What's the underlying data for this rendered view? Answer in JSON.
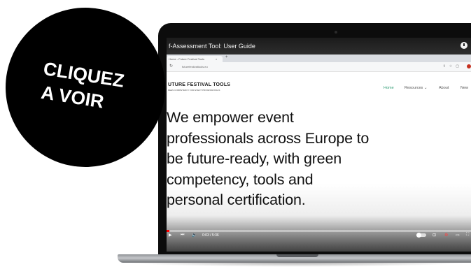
{
  "video": {
    "title": "f-Assessment Tool: User Guide",
    "time": "0:03 / 5:36",
    "progress_fraction": 0.01
  },
  "browser": {
    "tab_title": "Home - Future Festival Tools",
    "tab_close": "×",
    "new_tab": "+",
    "url": "futurefestivaltools.eu"
  },
  "site": {
    "logo_text": "UTURE FESTIVAL TOOLS",
    "logo_subtitle": "REEN COMPETENCY FOR EVENT PROFESSIONALS",
    "nav": {
      "home": "Home",
      "resources": "Resources ⌄",
      "about": "About",
      "news": "New"
    },
    "hero_text": "We empower event\nprofessionals across Europe to\nbe future-ready, with green\ncompetency, tools and\npersonal certification."
  },
  "badge": {
    "line1": "CLIQUEZ",
    "line2": "A VOIR"
  },
  "icons": {
    "play": "▶",
    "next": "⏭",
    "volume": "🔈",
    "cc": "⊡",
    "settings": "⚙",
    "miniplayer": "▭",
    "fullscreen": "⛶"
  },
  "colors": {
    "badge": "#000000",
    "progress": "#ff0000",
    "nav_active": "#2f9c74"
  }
}
